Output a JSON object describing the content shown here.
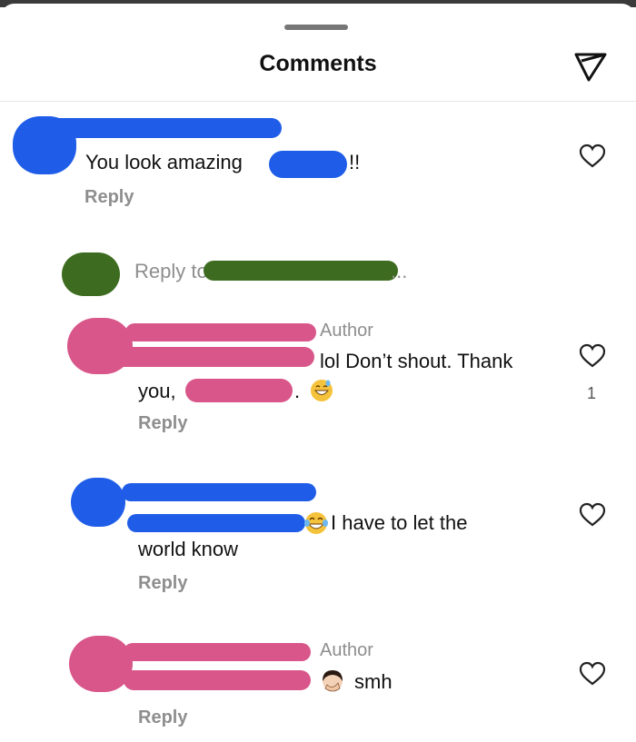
{
  "header": {
    "title": "Comments"
  },
  "comments": [
    {
      "text": "You look amazing",
      "text_suffix": "!!",
      "reply_label": "Reply"
    },
    {
      "view_replies": "Reply to",
      "ellipsis": "..."
    },
    {
      "author_badge": "Author",
      "text_line1": "lol Don’t shout. Thank",
      "text_line2": "you,",
      "text_tail": ".",
      "reply_label": "Reply",
      "like_count": "1"
    },
    {
      "text_line1": "I have to let the",
      "text_line2": "world know",
      "reply_label": "Reply"
    },
    {
      "author_badge": "Author",
      "text": "smh",
      "reply_label": "Reply"
    }
  ],
  "colors": {
    "scribble_blue": "#1f5de8",
    "scribble_green": "#3d6b1f",
    "scribble_pink": "#d8568a"
  },
  "icons": [
    "send-icon",
    "heart-icon",
    "grin-sweat-emoji",
    "tears-of-joy-emoji",
    "facepalm-emoji"
  ]
}
